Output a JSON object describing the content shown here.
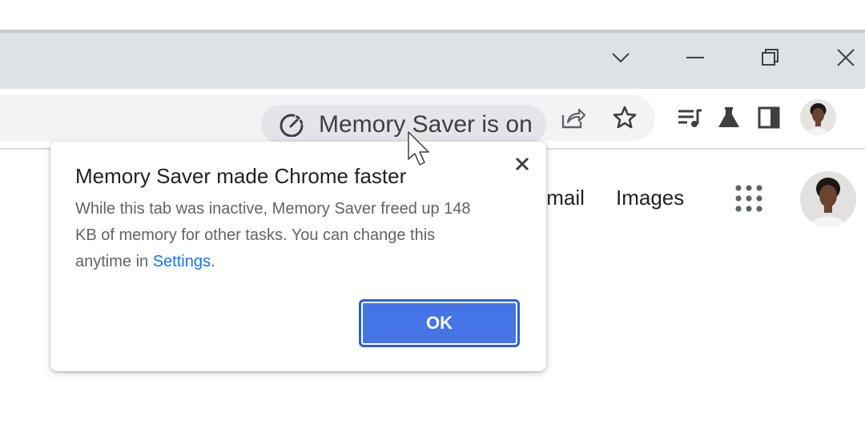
{
  "window": {
    "tab_search_icon": "chevron-down-icon",
    "minimize_icon": "minimize-icon",
    "restore_icon": "restore-icon",
    "close_icon": "close-icon"
  },
  "toolbar": {
    "memory_saver_chip": {
      "label": "Memory Saver is on",
      "icon": "speedometer-icon"
    },
    "share_icon": "share-icon",
    "bookmark_icon": "star-icon",
    "reading_list_icon": "reading-list-icon",
    "labs_icon": "flask-icon",
    "side_panel_icon": "side-panel-icon",
    "profile_icon": "avatar"
  },
  "page": {
    "links": [
      "Gmail",
      "Images"
    ],
    "apps_icon": "apps-grid-icon",
    "account_icon": "avatar"
  },
  "dialog": {
    "title": "Memory Saver made Chrome faster",
    "body_text": "While this tab was inactive, Memory Saver freed up 148 KB of memory for other tasks. You can change this anytime in ",
    "settings_link": "Settings",
    "body_end": ".",
    "ok_label": "OK",
    "close_icon": "close-icon"
  },
  "colors": {
    "accent": "#4474e6",
    "link": "#1a73e8",
    "titlebar": "#dee1e6",
    "omnibox": "#f1f3f4"
  }
}
